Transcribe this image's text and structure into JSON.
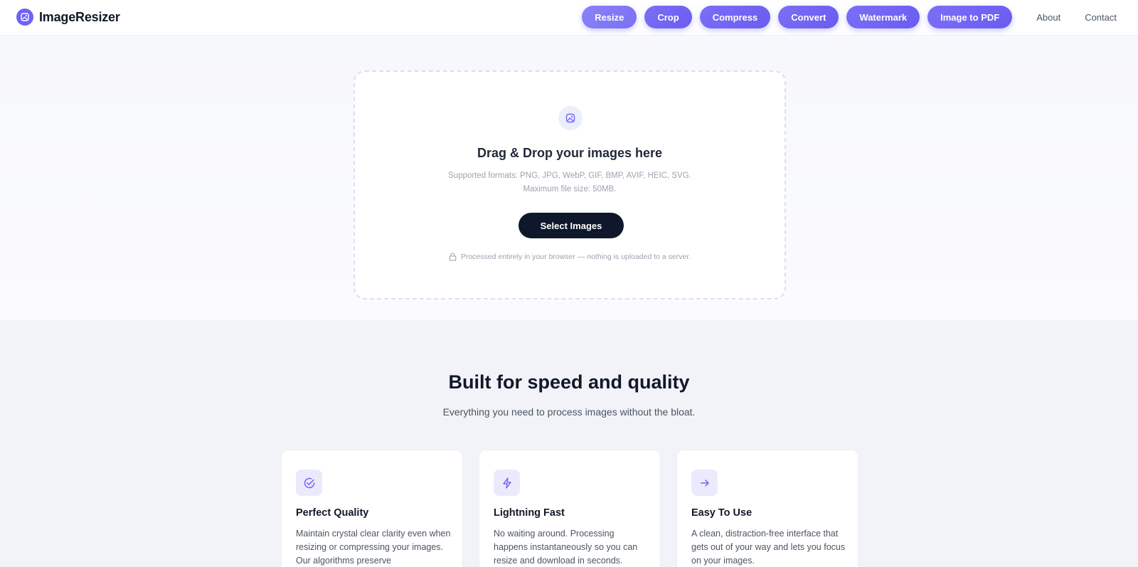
{
  "brand": {
    "name": "ImageResizer",
    "icon": "image-icon",
    "color": "#6c63f5"
  },
  "nav": {
    "pills": [
      {
        "label": "Resize"
      },
      {
        "label": "Crop"
      },
      {
        "label": "Compress"
      },
      {
        "label": "Convert"
      },
      {
        "label": "Watermark"
      },
      {
        "label": "Image to PDF"
      }
    ],
    "links": [
      {
        "label": "About"
      },
      {
        "label": "Contact"
      }
    ]
  },
  "dropzone": {
    "icon": "image-icon",
    "title": "Drag & Drop your images here",
    "formats": "Supported formats: PNG, JPG, WebP, GIF, BMP, AVIF, HEIC, SVG.",
    "max_size": "Maximum file size: 50MB.",
    "button": "Select Images",
    "privacy_icon": "lock-icon",
    "privacy": "Processed entirely in your browser — nothing is uploaded to a server."
  },
  "features": {
    "title": "Built for speed and quality",
    "subtitle": "Everything you need to process images without the bloat.",
    "cards": [
      {
        "icon": "check-circle-icon",
        "title": "Perfect Quality",
        "text": "Maintain crystal clear clarity even when resizing or compressing your images. Our algorithms preserve"
      },
      {
        "icon": "lightning-icon",
        "title": "Lightning Fast",
        "text": "No waiting around. Processing happens instantaneously so you can resize and download in seconds."
      },
      {
        "icon": "arrow-right-icon",
        "title": "Easy To Use",
        "text": "A clean, distraction-free interface that gets out of your way and lets you focus on your images."
      }
    ]
  },
  "colors": {
    "accent": "#6c63f5",
    "dark_button": "#0f172a"
  }
}
